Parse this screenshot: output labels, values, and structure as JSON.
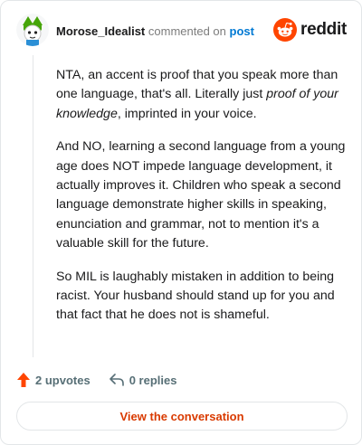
{
  "comment": {
    "username": "Morose_Idealist",
    "action_text": "commented on",
    "post_link": "post",
    "paragraphs": [
      {
        "a": "NTA, an accent is proof that you speak more than one language, that's all. Literally just ",
        "em": "proof of your knowledge",
        "b": ", imprinted in your voice."
      },
      {
        "a": "And NO, learning a second language from a young age does NOT impede language development, it actually improves it. Children who speak a second language demonstrate higher skills in speaking, enunciation and grammar, not to mention it's a valuable skill for the future."
      },
      {
        "a": "So MIL is laughably mistaken in addition to being racist. Your husband should stand up for you and that fact that he does not is shameful."
      }
    ],
    "upvotes": "2 upvotes",
    "replies": "0 replies"
  },
  "brand": {
    "name": "reddit",
    "color": "#ff4500"
  },
  "cta": {
    "label": "View the conversation"
  },
  "icons": {
    "avatar": "avatar",
    "brand": "reddit-logo-icon",
    "upvote": "upvote-arrow-icon",
    "reply": "reply-arrow-icon"
  },
  "colors": {
    "accent": "#d93a00",
    "link": "#0079d3",
    "upvote": "#ff4500"
  }
}
